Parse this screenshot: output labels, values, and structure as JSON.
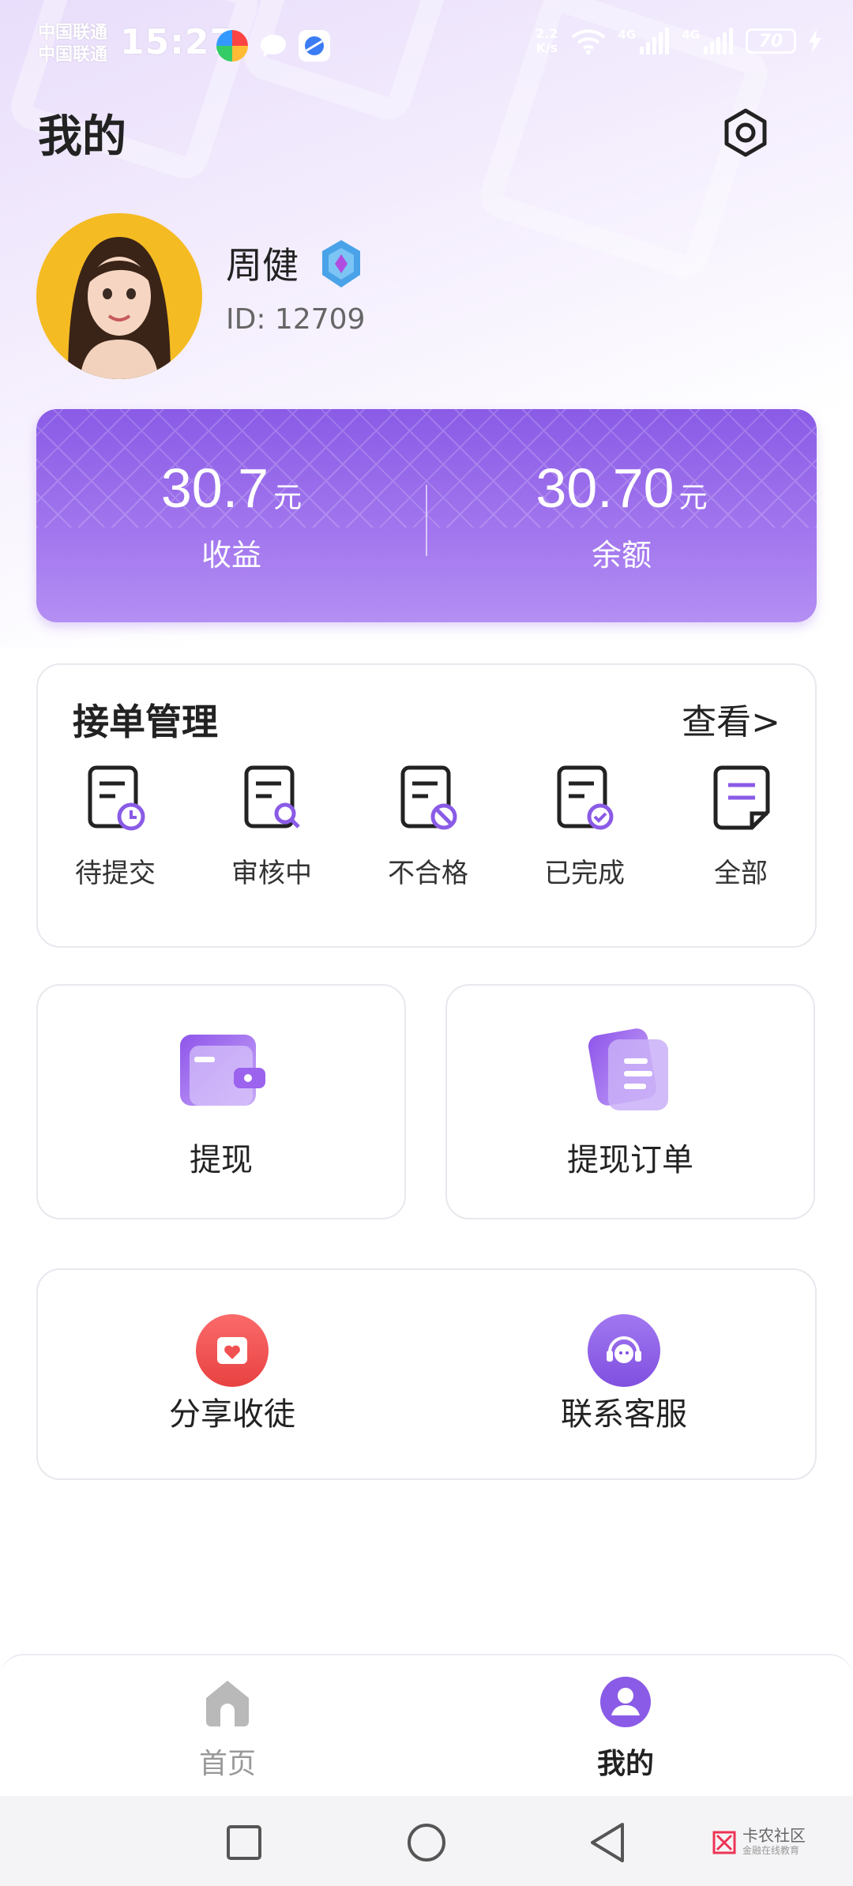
{
  "status_bar": {
    "carrier_1": "中国联通",
    "carrier_2": "中国联通",
    "time": "15:27",
    "net_speed_value": "2.2",
    "net_speed_unit": "K/s",
    "signal_1_label": "4G",
    "signal_2_label": "4G",
    "battery": "70"
  },
  "header": {
    "title": "我的",
    "settings_icon": "settings-hexagon-icon"
  },
  "profile": {
    "name": "周健",
    "id_text": "ID: 12709"
  },
  "earnings": {
    "income_value": "30.7",
    "income_unit": "元",
    "income_label": "收益",
    "balance_value": "30.70",
    "balance_unit": "元",
    "balance_label": "余额"
  },
  "orders": {
    "title": "接单管理",
    "view_more": "查看>",
    "items": [
      {
        "label": "待提交",
        "icon": "doc-clock-icon"
      },
      {
        "label": "审核中",
        "icon": "doc-search-icon"
      },
      {
        "label": "不合格",
        "icon": "doc-ban-icon"
      },
      {
        "label": "已完成",
        "icon": "doc-check-icon"
      },
      {
        "label": "全部",
        "icon": "doc-all-icon"
      }
    ]
  },
  "withdraw": {
    "withdraw_label": "提现",
    "withdraw_orders_label": "提现订单"
  },
  "services": {
    "share_label": "分享收徒",
    "support_label": "联系客服"
  },
  "bottom_nav": {
    "home_label": "首页",
    "mine_label": "我的"
  },
  "watermark": {
    "title": "卡农社区",
    "subtitle": "金融在线教育"
  },
  "colors": {
    "accent": "#8a5be6",
    "accent_light": "#b48ff3",
    "text_dark": "#222222",
    "text_gray": "#666666"
  }
}
